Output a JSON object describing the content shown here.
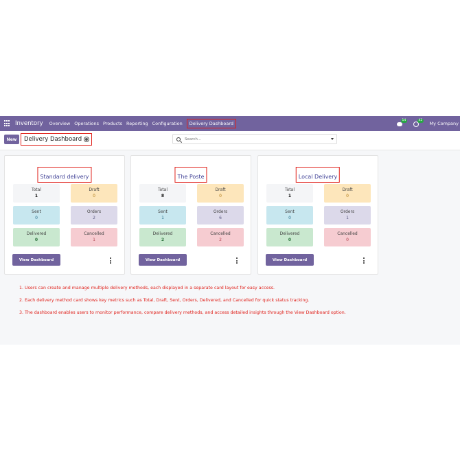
{
  "navbar": {
    "brand": "Inventory",
    "menu": [
      "Overview",
      "Operations",
      "Products",
      "Reporting",
      "Configuration"
    ],
    "active_item": "Delivery Dashboard",
    "messages_badge": "14",
    "activities_badge": "42",
    "company": "My Company"
  },
  "control": {
    "new_label": "New",
    "breadcrumb": "Delivery Dashboard",
    "search_placeholder": "Search..."
  },
  "tile_labels": {
    "total": "Total",
    "draft": "Draft",
    "sent": "Sent",
    "orders": "Orders",
    "delivered": "Delivered",
    "cancelled": "Cancelled"
  },
  "cards": [
    {
      "title": "Standard delivery",
      "total": "1",
      "draft": "0",
      "sent": "0",
      "orders": "2",
      "delivered": "0",
      "cancelled": "1",
      "button": "View Dashboard"
    },
    {
      "title": "The Poste",
      "total": "8",
      "draft": "0",
      "sent": "1",
      "orders": "6",
      "delivered": "2",
      "cancelled": "2",
      "button": "View Dashboard"
    },
    {
      "title": "Local Delivery",
      "total": "1",
      "draft": "0",
      "sent": "0",
      "orders": "1",
      "delivered": "0",
      "cancelled": "0",
      "button": "View Dashboard"
    }
  ],
  "notes": [
    "1. Users can create and manage multiple delivery methods, each displayed in a separate card layout for easy access.",
    "2. Each delivery method card shows key metrics such as Total, Draft, Sent, Orders, Delivered, and Cancelled for quick status tracking.",
    "3. The dashboard enables users to monitor performance, compare delivery methods, and access detailed insights through the View Dashboard option."
  ],
  "colors": {
    "navbar": "#71639e",
    "highlight": "#e0201a",
    "card_title": "#3e3f95"
  }
}
